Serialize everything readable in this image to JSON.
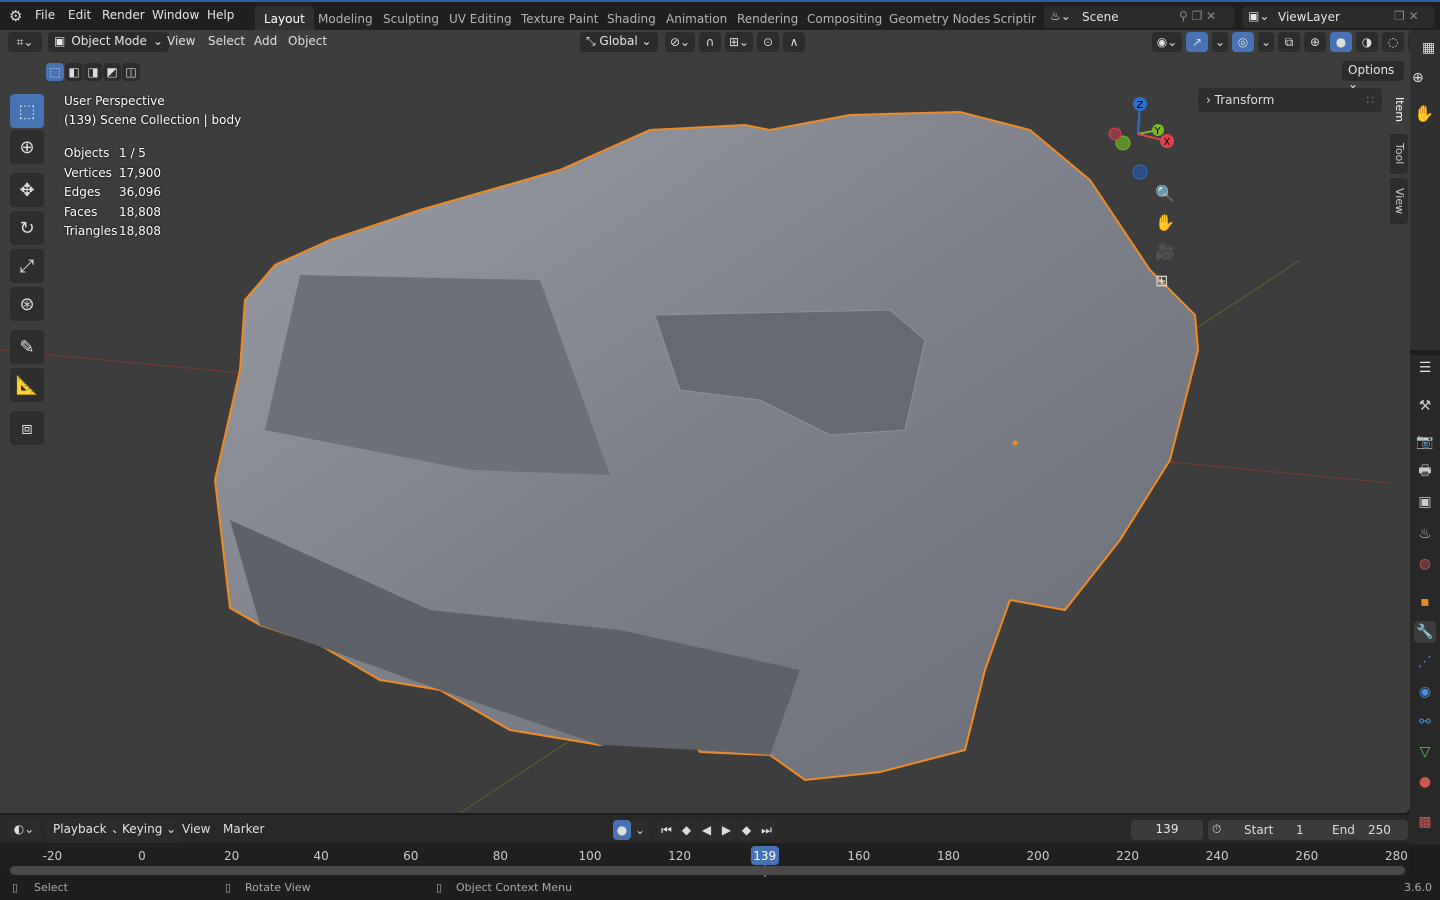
{
  "menu": [
    "File",
    "Edit",
    "Render",
    "Window",
    "Help"
  ],
  "workspaces": [
    "Layout",
    "Modeling",
    "Sculpting",
    "UV Editing",
    "Texture Paint",
    "Shading",
    "Animation",
    "Rendering",
    "Compositing",
    "Geometry Nodes",
    "Scripting"
  ],
  "scene": "Scene",
  "view_layer": "ViewLayer",
  "header": {
    "mode": "Object Mode",
    "menus": [
      "View",
      "Select",
      "Add",
      "Object"
    ],
    "orientation": "Global",
    "options": "Options"
  },
  "overlay": {
    "view_name": "User Perspective",
    "collection": "(139) Scene Collection | body",
    "stats": [
      {
        "label": "Objects",
        "value": "1 / 5"
      },
      {
        "label": "Vertices",
        "value": "17,900"
      },
      {
        "label": "Edges",
        "value": "36,096"
      },
      {
        "label": "Faces",
        "value": "18,808"
      },
      {
        "label": "Triangles",
        "value": "18,808"
      }
    ]
  },
  "gizmo": {
    "z": "Z",
    "y": "Y",
    "x": "X"
  },
  "sidebar": {
    "tabs": [
      "Item",
      "Tool",
      "View"
    ],
    "panel": "Transform"
  },
  "timeline": {
    "menus": [
      "Playback",
      "Keying",
      "View",
      "Marker"
    ],
    "current_frame": "139",
    "start_label": "Start",
    "start": "1",
    "end_label": "End",
    "end": "250",
    "ticks": [
      "-20",
      "0",
      "20",
      "40",
      "60",
      "80",
      "100",
      "120",
      "139",
      "160",
      "180",
      "200",
      "220",
      "240",
      "260",
      "280"
    ]
  },
  "status": {
    "select": "Select",
    "rotate": "Rotate View",
    "context": "Object Context Menu",
    "version": "3.6.0"
  },
  "colors": {
    "accent": "#4772b3",
    "selection_outline": "#f08a24"
  }
}
